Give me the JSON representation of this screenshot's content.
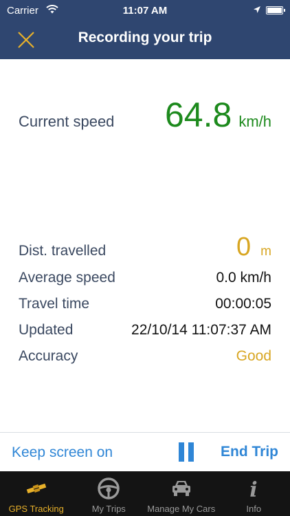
{
  "status_bar": {
    "carrier": "Carrier",
    "time": "11:07 AM",
    "icons": [
      "wifi-icon",
      "location-arrow-icon",
      "battery-icon"
    ]
  },
  "nav": {
    "title": "Recording your trip",
    "close_icon": "close-icon"
  },
  "current_speed": {
    "label": "Current speed",
    "value": "64.8",
    "unit": "km/h",
    "color": "#1d8a1d"
  },
  "stats": {
    "distance": {
      "label": "Dist. travelled",
      "value": "0",
      "unit": "m",
      "color": "#d8a622"
    },
    "average_speed": {
      "label": "Average speed",
      "value": "0.0 km/h"
    },
    "travel_time": {
      "label": "Travel time",
      "value": "00:00:05"
    },
    "updated": {
      "label": "Updated",
      "value": "22/10/14 11:07:37 AM"
    },
    "accuracy": {
      "label": "Accuracy",
      "value": "Good",
      "color": "#d8a622"
    }
  },
  "actions": {
    "keep_screen": "Keep screen on",
    "pause_icon": "pause-icon",
    "end_trip": "End Trip",
    "accent": "#2f86d6"
  },
  "tabs": [
    {
      "label": "GPS Tracking",
      "icon": "satellite-icon",
      "active": true
    },
    {
      "label": "My Trips",
      "icon": "steering-wheel-icon",
      "active": false
    },
    {
      "label": "Manage My Cars",
      "icon": "car-icon",
      "active": false
    },
    {
      "label": "Info",
      "icon": "info-icon",
      "active": false
    }
  ],
  "colors": {
    "header": "#2f4670",
    "tab_active": "#e8b12a",
    "tab_bar": "#141414"
  }
}
